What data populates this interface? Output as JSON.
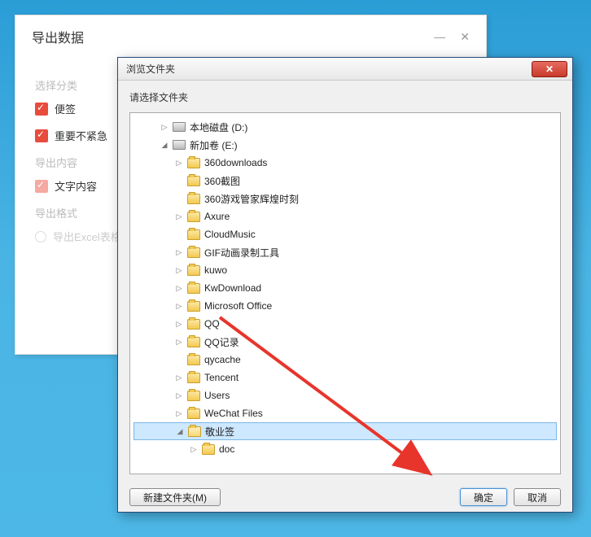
{
  "export": {
    "title": "导出数据",
    "section_category": "选择分类",
    "chk_sticky": "便签",
    "chk_important": "重要不紧急",
    "section_content": "导出内容",
    "chk_text": "文字内容",
    "section_format": "导出格式",
    "radio_excel": "导出Excel表格"
  },
  "dialog": {
    "title": "浏览文件夹",
    "instruction": "请选择文件夹",
    "new_folder_btn": "新建文件夹(M)",
    "ok_btn": "确定",
    "cancel_btn": "取消",
    "tree": [
      {
        "indent": 1,
        "expander": "▷",
        "icon": "drive",
        "label": "本地磁盘 (D:)",
        "selected": false
      },
      {
        "indent": 1,
        "expander": "◢",
        "icon": "drive",
        "label": "新加卷 (E:)",
        "selected": false
      },
      {
        "indent": 2,
        "expander": "▷",
        "icon": "folder",
        "label": "360downloads",
        "selected": false
      },
      {
        "indent": 2,
        "expander": "",
        "icon": "folder",
        "label": "360截图",
        "selected": false
      },
      {
        "indent": 2,
        "expander": "",
        "icon": "folder",
        "label": "360游戏管家辉煌时刻",
        "selected": false
      },
      {
        "indent": 2,
        "expander": "▷",
        "icon": "folder",
        "label": "Axure",
        "selected": false
      },
      {
        "indent": 2,
        "expander": "",
        "icon": "folder",
        "label": "CloudMusic",
        "selected": false
      },
      {
        "indent": 2,
        "expander": "▷",
        "icon": "folder",
        "label": "GIF动画录制工具",
        "selected": false
      },
      {
        "indent": 2,
        "expander": "▷",
        "icon": "folder",
        "label": "kuwo",
        "selected": false
      },
      {
        "indent": 2,
        "expander": "▷",
        "icon": "folder",
        "label": "KwDownload",
        "selected": false
      },
      {
        "indent": 2,
        "expander": "▷",
        "icon": "folder",
        "label": "Microsoft Office",
        "selected": false
      },
      {
        "indent": 2,
        "expander": "▷",
        "icon": "folder",
        "label": "QQ",
        "selected": false
      },
      {
        "indent": 2,
        "expander": "▷",
        "icon": "folder",
        "label": "QQ记录",
        "selected": false
      },
      {
        "indent": 2,
        "expander": "",
        "icon": "folder",
        "label": "qycache",
        "selected": false
      },
      {
        "indent": 2,
        "expander": "▷",
        "icon": "folder",
        "label": "Tencent",
        "selected": false
      },
      {
        "indent": 2,
        "expander": "▷",
        "icon": "folder",
        "label": "Users",
        "selected": false
      },
      {
        "indent": 2,
        "expander": "▷",
        "icon": "folder",
        "label": "WeChat Files",
        "selected": false
      },
      {
        "indent": 2,
        "expander": "◢",
        "icon": "folder-open",
        "label": "敬业签",
        "selected": true
      },
      {
        "indent": 3,
        "expander": "▷",
        "icon": "folder",
        "label": "doc",
        "selected": false
      }
    ]
  }
}
